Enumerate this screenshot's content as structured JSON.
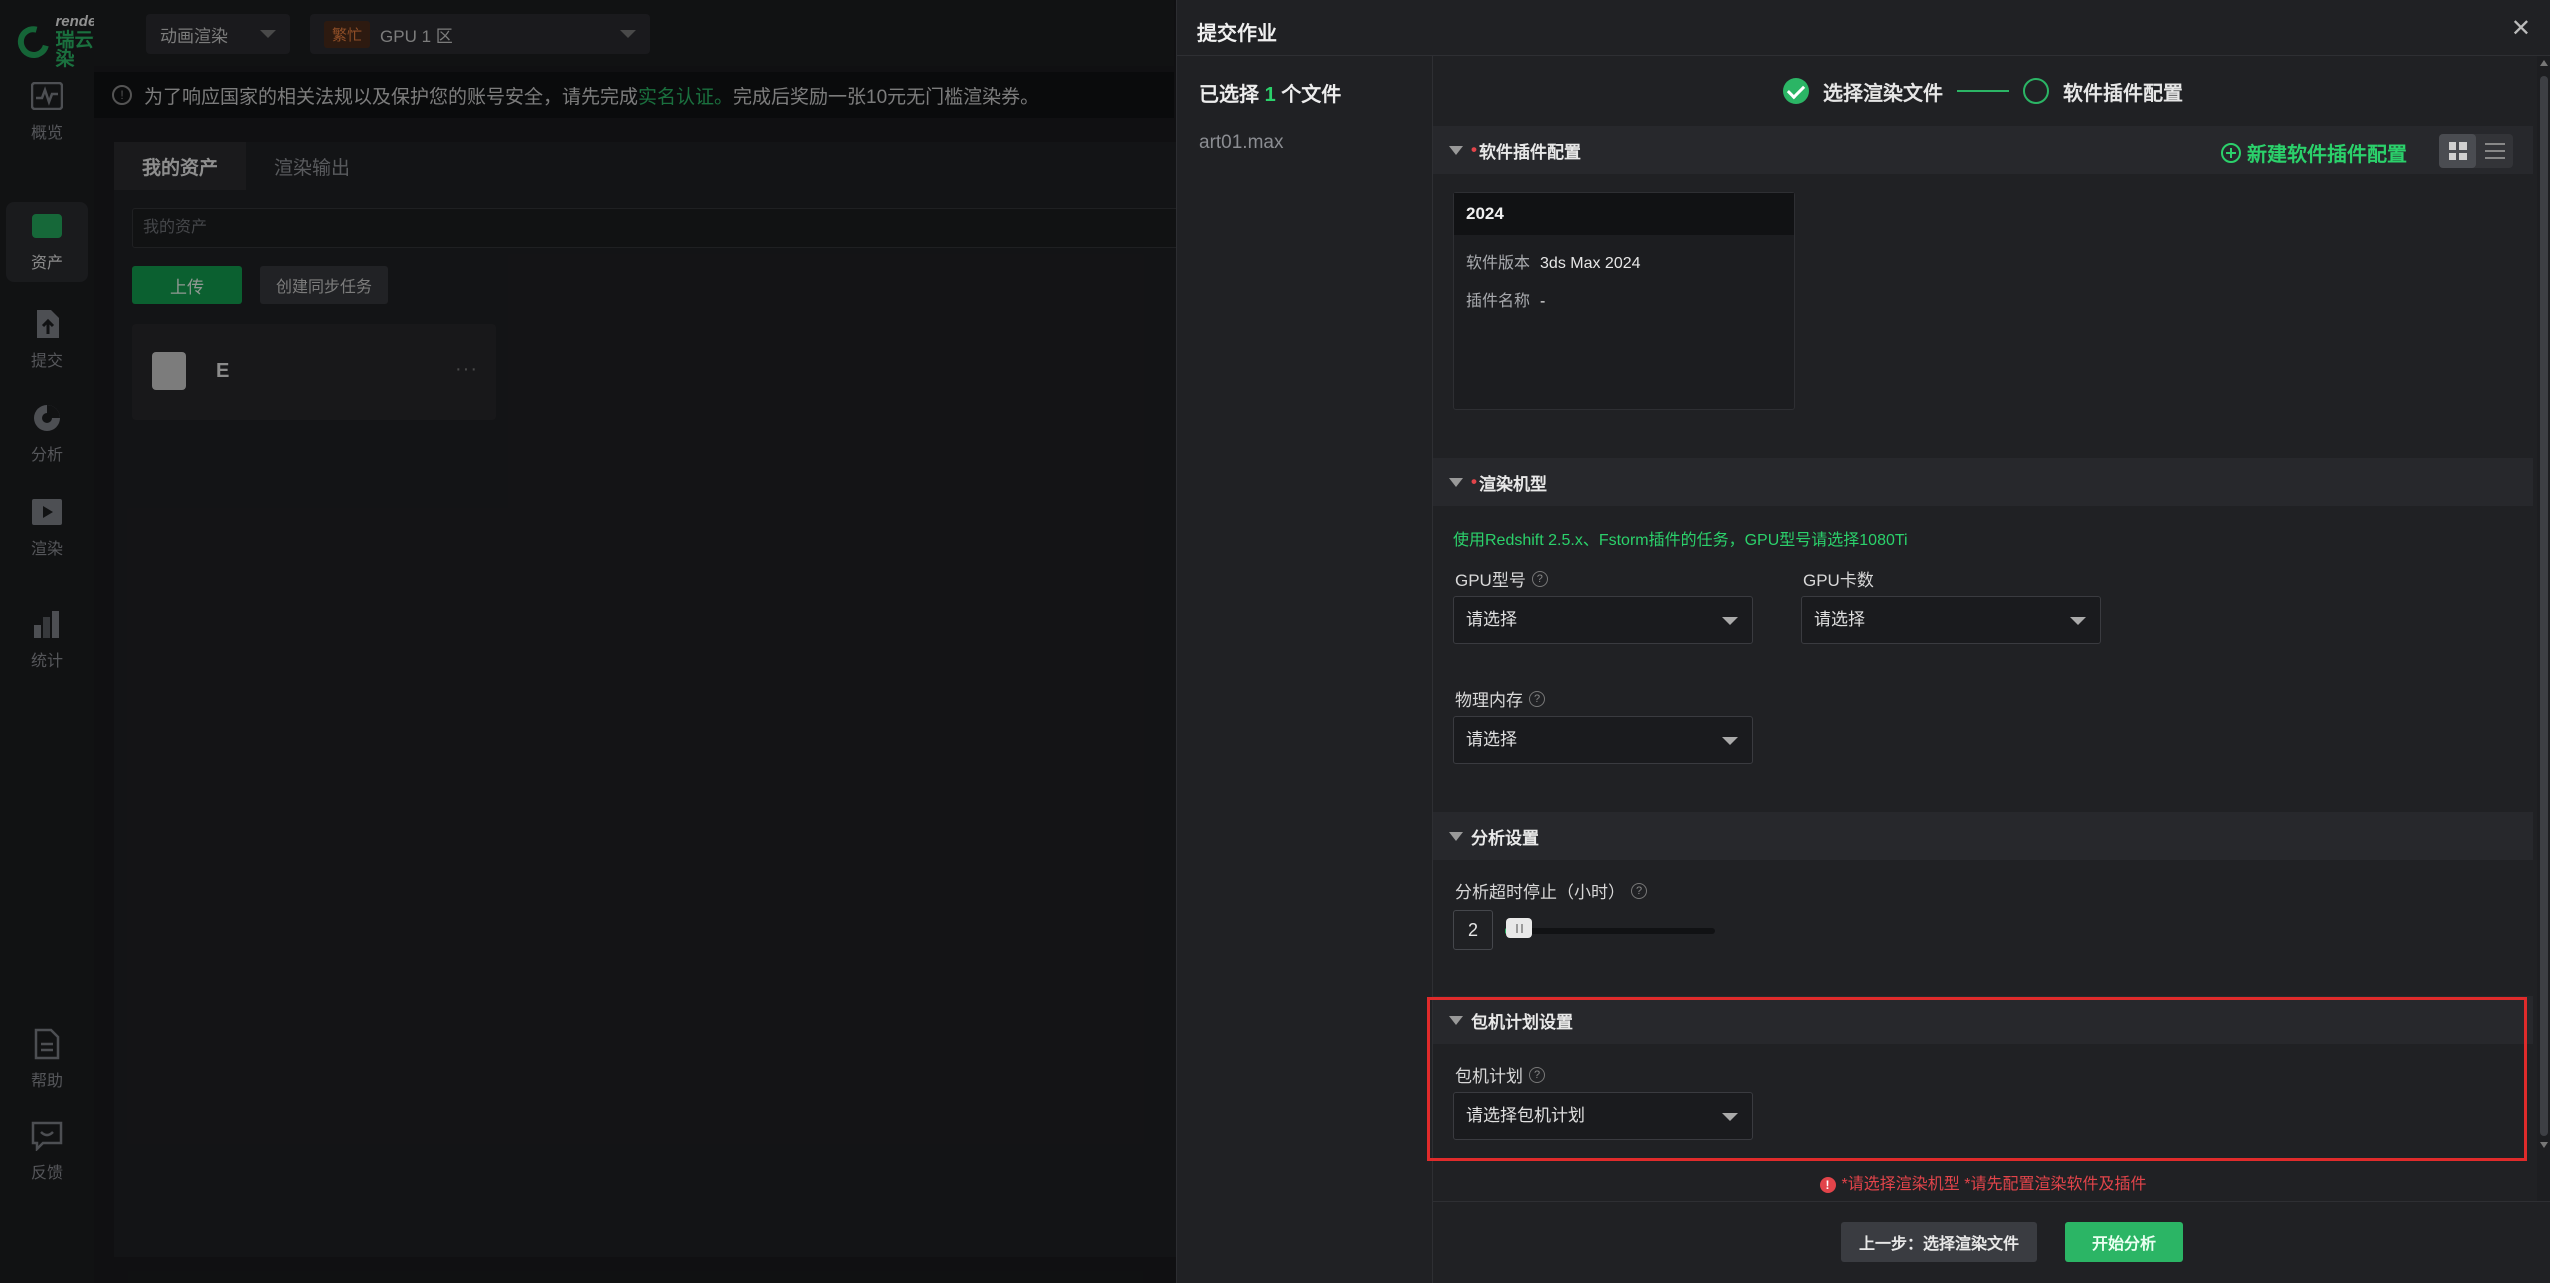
{
  "app": {
    "logo_en": "renderbus",
    "logo_cn": "瑞云渲染",
    "render_type": "动画渲染",
    "zone_status": "繁忙",
    "zone": "GPU 1 区"
  },
  "rail": [
    {
      "label": "概览",
      "icon": "pulse-chart-icon"
    },
    {
      "label": "资产",
      "icon": "folder-icon",
      "active": true
    },
    {
      "label": "提交",
      "icon": "upload-icon"
    },
    {
      "label": "分析",
      "icon": "pie-chart-icon"
    },
    {
      "label": "渲染",
      "icon": "play-icon"
    },
    {
      "label": "统计",
      "icon": "bar-chart-icon"
    },
    {
      "label": "帮助",
      "icon": "document-icon"
    },
    {
      "label": "反馈",
      "icon": "feedback-icon"
    }
  ],
  "notice": {
    "text_before": "为了响应国家的相关法规以及保护您的账号安全，请先完成",
    "link": "实名认证。",
    "text_after": "完成后奖励一张10元无门槛渲染券。"
  },
  "assets": {
    "tab_assets": "我的资产",
    "tab_output": "渲染输出",
    "search_placeholder": "我的资产",
    "upload_label": "上传",
    "sync_label": "创建同步任务",
    "drive_label": "E",
    "more_label": "···"
  },
  "drawer": {
    "title": "提交作业",
    "close": "✕",
    "selected_prefix": "已选择",
    "selected_count": "1",
    "selected_suffix": "个文件",
    "file": "art01.max",
    "step1": "选择渲染文件",
    "step2": "软件插件配置",
    "sections": {
      "plugin": {
        "title": "软件插件配置",
        "new_cfg": "新建软件插件配置",
        "card_name": "2024",
        "version_label": "软件版本",
        "version_value": "3ds Max 2024",
        "plugin_label": "插件名称",
        "plugin_value": "-"
      },
      "machine": {
        "title": "渲染机型",
        "tip": "使用Redshift 2.5.x、Fstorm插件的任务，GPU型号请选择1080Ti",
        "gpu_model_label": "GPU型号",
        "gpu_model_value": "请选择",
        "gpu_count_label": "GPU卡数",
        "gpu_count_value": "请选择",
        "memory_label": "物理内存",
        "memory_value": "请选择"
      },
      "analysis": {
        "title": "分析设置",
        "timeout_label": "分析超时停止（小时）",
        "timeout_value": "2",
        "timeout_level": 0.02
      },
      "plan": {
        "title": "包机计划设置",
        "plan_label": "包机计划",
        "plan_value": "请选择包机计划"
      }
    },
    "error": "*请选择渲染机型  *请先配置渲染软件及插件",
    "prev_button": "上一步：选择渲染文件",
    "start_button": "开始分析"
  },
  "colors": {
    "accent": "#2bb565",
    "error": "#e2444a",
    "highlight": "#e02b2b"
  }
}
